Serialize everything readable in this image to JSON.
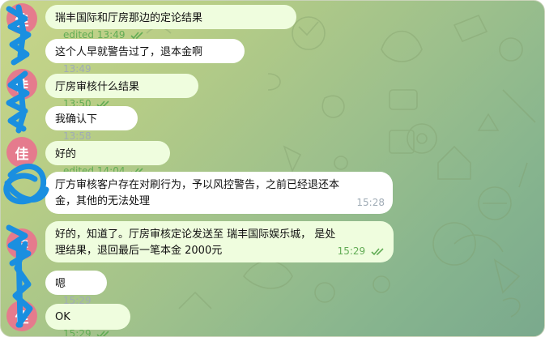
{
  "avatar_initial": "佳",
  "messages": [
    {
      "text": "瑞丰国际和厅房那边的定论结果",
      "edited": "edited",
      "time": "13:49",
      "read": true
    },
    {
      "text": "这个人早就警告过了，退本金啊",
      "edited": "",
      "time": "13:49",
      "read": false
    },
    {
      "text": "厅房审核什么结果",
      "edited": "",
      "time": "13:50",
      "read": true
    },
    {
      "text": "我确认下",
      "edited": "",
      "time": "13:58",
      "read": false
    },
    {
      "text": "好的",
      "edited": "edited",
      "time": "14:04",
      "read": true
    },
    {
      "text": "厅方审核客户存在对刷行为，予以风控警告，之前已经退还本金，其他的无法处理",
      "edited": "",
      "time": "15:28",
      "read": false
    },
    {
      "text": "好的，知道了。厅房审核定论发送至 瑞丰国际娱乐城， 是处理结果，退回最后一笔本金 2000元",
      "edited": "",
      "time": "15:29",
      "read": true
    },
    {
      "text": "嗯",
      "edited": "",
      "time": "15:29",
      "read": false
    },
    {
      "text": "OK",
      "edited": "",
      "time": "15:29",
      "read": true
    }
  ],
  "icons": {
    "read_receipt": "double-check-icon"
  },
  "colors": {
    "outgoing_bubble": "#effdde",
    "incoming_bubble": "#ffffff",
    "avatar": "#e57b8d",
    "scribble": "#1a8fe0"
  }
}
